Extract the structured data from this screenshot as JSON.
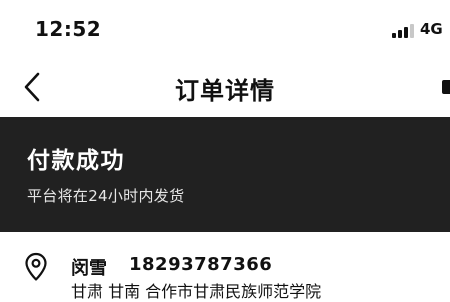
{
  "status_bar": {
    "time": "12:52",
    "network": "4G",
    "signal_bars_filled": 3,
    "signal_bars_total": 4
  },
  "nav": {
    "title": "订单详情",
    "back_icon": "chevron-left-icon"
  },
  "status_banner": {
    "title": "付款成功",
    "subtitle": "平台将在24小时内发货",
    "background_color": "#212121"
  },
  "address": {
    "icon": "location-pin-icon",
    "name": "闵雪",
    "phone": "18293787366",
    "address_line": "甘肃 甘南 合作市甘肃民族师范学院"
  }
}
